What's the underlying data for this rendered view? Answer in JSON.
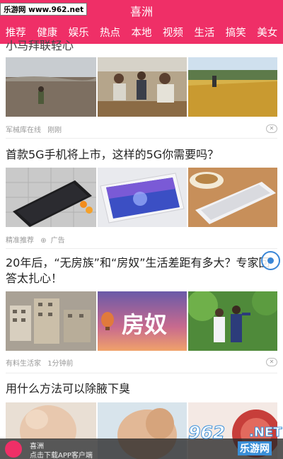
{
  "watermark_top": "乐游网 www.962.net",
  "header": {
    "title": "喜洲"
  },
  "nav": [
    "推荐",
    "健康",
    "娱乐",
    "热点",
    "本地",
    "视频",
    "生活",
    "搞笑",
    "美女"
  ],
  "articles": [
    {
      "title": "小马拜联轻心",
      "meta": [
        "军械库在线",
        "刚刚"
      ],
      "thumbs": [
        "farmer-in-dry-field",
        "villagers-sitting-photo",
        "golden-rice-field"
      ]
    },
    {
      "title": "首款5G手机将上市，这样的5G你需要吗？",
      "meta": [
        "精准推荐",
        "广告"
      ],
      "thumbs": [
        "black-phone-on-tiles",
        "white-phone-on-wood",
        "phone-with-coffee"
      ]
    },
    {
      "title": "20年后，“无房族”和“房奴”生活差距有多大？专家回答太扎心！",
      "meta": [
        "有料生活家",
        "1分钟前"
      ],
      "thumbs": [
        "city-buildings",
        "fangnu-calligraphy",
        "couple-outdoor-photo"
      ],
      "thumb_caption": "房奴"
    },
    {
      "title": "用什么方法可以除腋下臭",
      "thumbs": [
        "woman-armpit",
        "person-raising-arm",
        "red-illustration"
      ]
    }
  ],
  "bottom_banner": {
    "name": "喜洲",
    "subtitle": "点击下载APP客户端"
  },
  "watermark_bottom": {
    "number": "962",
    "tld": ".NET",
    "name": "乐游网"
  },
  "colors": {
    "brand": "#ef2f67",
    "text": "#222222",
    "meta": "#999999",
    "accent_blue": "#3a86d6"
  }
}
